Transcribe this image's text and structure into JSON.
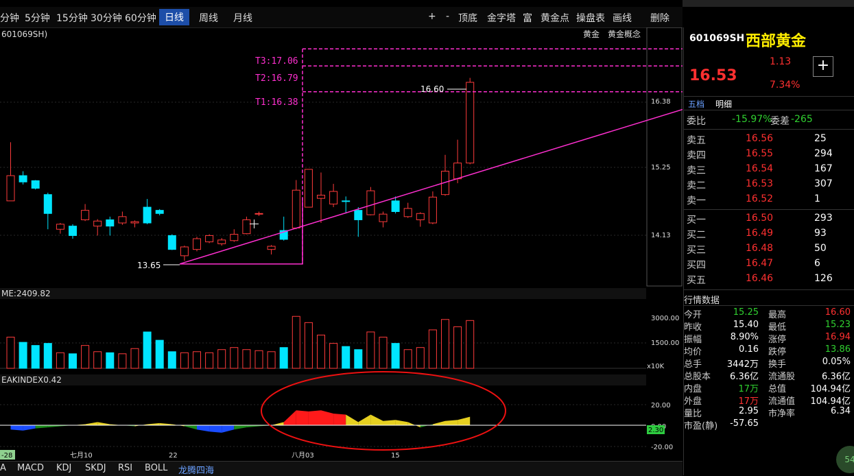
{
  "periods": [
    "分钟",
    "5分钟",
    "15分钟",
    "30分钟",
    "60分钟",
    "日线",
    "周线",
    "月线"
  ],
  "active_period": "日线",
  "tools": [
    "+",
    "-",
    "顶底",
    "金字塔",
    "富",
    "黄金点",
    "操盘表",
    "画线",
    "删除"
  ],
  "chart": {
    "code_label": "601069SH)",
    "tags": [
      "黄金",
      "黄金概念"
    ],
    "targets": [
      "T3:17.06",
      "T2:16.79",
      "T1:16.38"
    ],
    "high_label": "16.60",
    "low_label": "13.65",
    "price_ticks": [
      "16.38",
      "15.25",
      "14.13"
    ],
    "volume_label": "ME:2409.82",
    "volume_ticks": [
      "3000.00",
      "1500.00",
      "x10K"
    ],
    "indicator_label": "EAKINDEX0.42",
    "indicator_ticks": [
      "20.00",
      "0.00",
      "-20.00"
    ],
    "indicator_current": "2.30",
    "date_labels": [
      "-28",
      "七月10",
      "22",
      "八月03",
      "15"
    ]
  },
  "chart_data": {
    "type": "candlestick",
    "candles": [
      [
        14.65,
        15.05,
        15.58,
        14.98
      ],
      [
        15.05,
        14.95,
        15.12,
        14.91
      ],
      [
        14.97,
        14.85,
        14.98,
        14.83
      ],
      [
        14.75,
        14.45,
        14.78,
        14.2
      ],
      [
        14.2,
        14.28,
        14.3,
        14.13
      ],
      [
        14.25,
        14.1,
        14.28,
        14.05
      ],
      [
        14.35,
        14.5,
        14.6,
        14.33
      ],
      [
        14.25,
        14.33,
        14.36,
        14.1
      ],
      [
        14.35,
        14.25,
        14.4,
        14.1
      ],
      [
        14.3,
        14.4,
        14.48,
        14.27
      ],
      [
        14.3,
        14.32,
        14.34,
        14.23
      ],
      [
        14.55,
        14.3,
        14.68,
        14.28
      ],
      [
        14.5,
        14.45,
        14.52,
        14.42
      ],
      [
        14.1,
        13.88,
        14.12,
        13.87
      ],
      [
        13.78,
        13.92,
        13.94,
        13.7
      ],
      [
        13.88,
        14.05,
        14.08,
        13.85
      ],
      [
        14.0,
        14.1,
        14.12,
        13.98
      ],
      [
        13.97,
        14.03,
        14.06,
        13.94
      ],
      [
        14.02,
        14.12,
        14.2,
        14.0
      ],
      [
        14.13,
        14.35,
        14.4,
        14.12
      ],
      [
        14.45,
        14.45,
        14.48,
        14.41
      ],
      [
        13.88,
        13.93,
        13.95,
        13.8
      ],
      [
        14.18,
        14.04,
        14.4,
        14.02
      ],
      [
        14.22,
        14.82,
        14.98,
        14.2
      ],
      [
        14.55,
        15.15,
        15.15,
        14.55
      ],
      [
        14.69,
        14.74,
        15.1,
        14.3
      ],
      [
        14.6,
        14.8,
        14.92,
        14.55
      ],
      [
        14.65,
        14.64,
        14.72,
        14.45
      ],
      [
        14.5,
        14.35,
        14.55,
        14.08
      ],
      [
        14.43,
        14.81,
        14.87,
        14.42
      ],
      [
        14.32,
        14.44,
        14.48,
        14.23
      ],
      [
        14.65,
        14.48,
        14.72,
        14.45
      ],
      [
        14.4,
        14.53,
        14.62,
        14.38
      ],
      [
        14.35,
        14.45,
        14.47,
        14.24
      ],
      [
        14.3,
        14.71,
        14.8,
        14.28
      ],
      [
        14.75,
        15.12,
        15.38,
        14.73
      ],
      [
        15.0,
        15.25,
        15.62,
        14.93
      ],
      [
        15.25,
        16.53,
        16.6,
        15.23
      ]
    ],
    "volume": [
      1500,
      1250,
      1100,
      1200,
      750,
      700,
      1100,
      800,
      750,
      700,
      950,
      1750,
      1350,
      800,
      750,
      800,
      750,
      900,
      1000,
      900,
      850,
      800,
      1000,
      2500,
      2200,
      1600,
      1200,
      1050,
      900,
      1750,
      1500,
      1200,
      900,
      1000,
      1850,
      2350,
      2000,
      2300
    ],
    "indicator": [
      -4,
      -5,
      -3,
      -2,
      -1,
      0,
      1,
      3,
      1,
      0,
      -1,
      1,
      2,
      1,
      -1,
      -4,
      -6,
      -7,
      -4,
      -2,
      -1,
      0,
      3,
      14,
      13,
      14,
      11,
      10,
      3,
      10,
      4,
      5,
      3,
      -2,
      1,
      4,
      5,
      8
    ],
    "ma_line": [
      13.65,
      16.53
    ],
    "ylim": [
      13.3,
      17.4
    ]
  },
  "stock": {
    "code": "601069SH",
    "name": "西部黄金",
    "price": "16.53",
    "change": "1.13",
    "pct": "7.34%"
  },
  "side_tabs": [
    "五档",
    "明细"
  ],
  "weibi": {
    "label": "委比",
    "value": "-15.97%",
    "diff_label": "委差",
    "diff": "-265"
  },
  "sells": [
    {
      "label": "卖五",
      "price": "16.56",
      "vol": "25"
    },
    {
      "label": "卖四",
      "price": "16.55",
      "vol": "294"
    },
    {
      "label": "卖三",
      "price": "16.54",
      "vol": "167"
    },
    {
      "label": "卖二",
      "price": "16.53",
      "vol": "307"
    },
    {
      "label": "卖一",
      "price": "16.52",
      "vol": "1"
    }
  ],
  "buys": [
    {
      "label": "买一",
      "price": "16.50",
      "vol": "293"
    },
    {
      "label": "买二",
      "price": "16.49",
      "vol": "93"
    },
    {
      "label": "买三",
      "price": "16.48",
      "vol": "50"
    },
    {
      "label": "买四",
      "price": "16.47",
      "vol": "6"
    },
    {
      "label": "买五",
      "price": "16.46",
      "vol": "126"
    }
  ],
  "quote_title": "行情数据",
  "quotes": [
    {
      "l1": "今开",
      "v1": "15.25",
      "c1": "green",
      "l2": "最高",
      "v2": "16.60",
      "c2": "red"
    },
    {
      "l1": "昨收",
      "v1": "15.40",
      "c1": "white",
      "l2": "最低",
      "v2": "15.23",
      "c2": "green"
    },
    {
      "l1": "振幅",
      "v1": "8.90%",
      "c1": "white",
      "l2": "涨停",
      "v2": "16.94",
      "c2": "red"
    },
    {
      "l1": "均价",
      "v1": "0.16",
      "c1": "white",
      "l2": "跌停",
      "v2": "13.86",
      "c2": "green"
    },
    {
      "l1": "总手",
      "v1": "3442万",
      "c1": "white",
      "l2": "换手",
      "v2": "0.05%",
      "c2": "white"
    },
    {
      "l1": "总股本",
      "v1": "6.36亿",
      "c1": "white",
      "l2": "流通股",
      "v2": "6.36亿",
      "c2": "white"
    },
    {
      "l1": "内盘",
      "v1": "17万",
      "c1": "green",
      "l2": "总值",
      "v2": "104.94亿",
      "c2": "white"
    },
    {
      "l1": "外盘",
      "v1": "17万",
      "c1": "red",
      "l2": "流通值",
      "v2": "104.94亿",
      "c2": "white"
    },
    {
      "l1": "量比",
      "v1": "2.95",
      "c1": "white",
      "l2": "市净率",
      "v2": "6.34",
      "c2": "white"
    },
    {
      "l1": "市盈(静)",
      "v1": "-57.65",
      "c1": "white",
      "l2": "",
      "v2": "",
      "c2": "white"
    }
  ],
  "bottom_tabs": [
    "A",
    "MACD",
    "KDJ",
    "SKDJ",
    "RSI",
    "BOLL",
    "龙腾四海"
  ],
  "colors": {
    "up": "#ff3b3b",
    "down": "#00e5ff",
    "target": "#ff2fd0",
    "active": "#1d4ea8"
  }
}
